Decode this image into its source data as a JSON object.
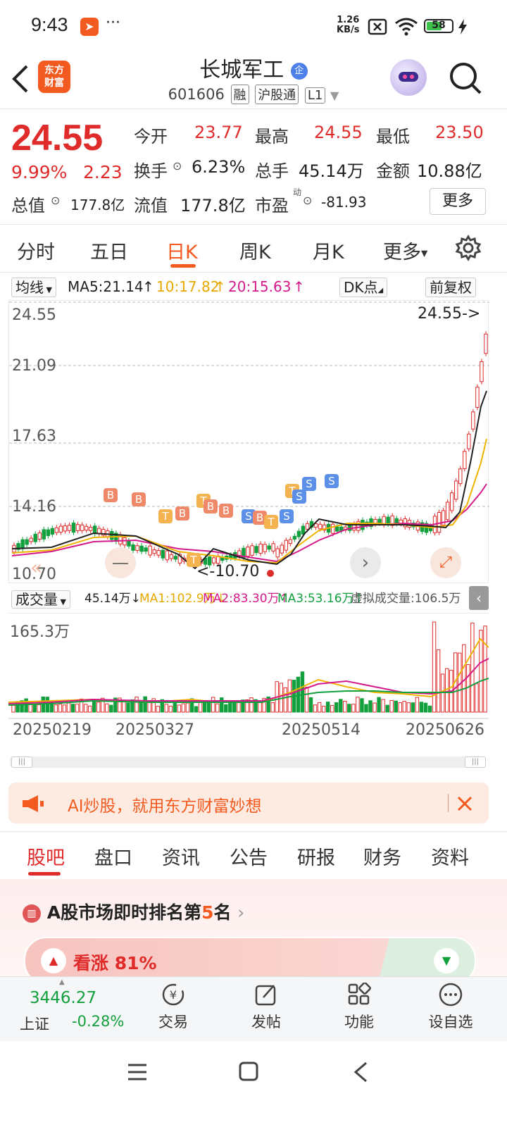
{
  "status_bar": {
    "time": "9:43",
    "dots": "···",
    "net_speed_top": "1.26",
    "net_speed_bottom": "KB/s",
    "battery": "58"
  },
  "header": {
    "title": "长城军工",
    "badge": "企",
    "code": "601606",
    "tags": [
      "融",
      "沪股通",
      "L1"
    ],
    "logo_top": "东方",
    "logo_bottom": "财富"
  },
  "quote": {
    "price": "24.55",
    "change_pct": "9.99%",
    "change": "2.23",
    "open_label": "今开",
    "open": "23.77",
    "high_label": "最高",
    "high": "24.55",
    "low_label": "最低",
    "low": "23.50",
    "turnover_label": "换手",
    "turnover": "6.23%",
    "volume_label": "总手",
    "volume": "45.14万",
    "amount_label": "金额",
    "amount": "10.88亿",
    "mcap_label": "总值",
    "mcap": "177.8亿",
    "float_label": "流值",
    "float": "177.8亿",
    "pe_label": "市盈",
    "pe_sup": "动",
    "pe": "-81.93",
    "more": "更多"
  },
  "period_tabs": {
    "items": [
      "分时",
      "五日",
      "日K",
      "周K",
      "月K",
      "更多"
    ],
    "active": "日K"
  },
  "ma_bar": {
    "selector": "均线",
    "ma5": "MA5:21.14",
    "ma10": "10:17.82",
    "ma20": "20:15.63",
    "dk": "DK点",
    "adjust": "前复权"
  },
  "kline": {
    "y_labels": [
      "24.55",
      "21.09",
      "17.63",
      "14.16",
      "10.70"
    ],
    "last_price_label": "24.55->",
    "low_marker": "<-10.70",
    "colors": {
      "up": "#e02b2b",
      "down": "#12a03e",
      "ma5": "#222222",
      "ma10": "#f0b400",
      "ma20": "#d6198a"
    }
  },
  "volume": {
    "selector": "成交量",
    "vol": "45.14万",
    "ma1": "MA1:102.9万",
    "ma2": "MA2:83.30万",
    "ma3": "MA3:53.16万",
    "virtual": "虚拟成交量:106.5万",
    "max_label": "165.3万"
  },
  "x_axis": {
    "labels": [
      "20250219",
      "20250327",
      "20250514",
      "20250626"
    ]
  },
  "banner": {
    "text": "AI炒股，就用东方财富妙想"
  },
  "bottom_tabs": {
    "items": [
      "股吧",
      "盘口",
      "资讯",
      "公告",
      "研报",
      "财务",
      "资料"
    ],
    "active": "股吧"
  },
  "ranking": {
    "prefix": "A股市场即时排名第",
    "rank": "5",
    "suffix": "名"
  },
  "sentiment": {
    "bull_label": "看涨",
    "bull_pct": "81%",
    "bull_fraction": 0.81
  },
  "bottom_nav": {
    "index_value": "3446.27",
    "index_name": "上证",
    "index_change": "-0.28%",
    "items": [
      "交易",
      "发帖",
      "功能",
      "设自选"
    ]
  }
}
